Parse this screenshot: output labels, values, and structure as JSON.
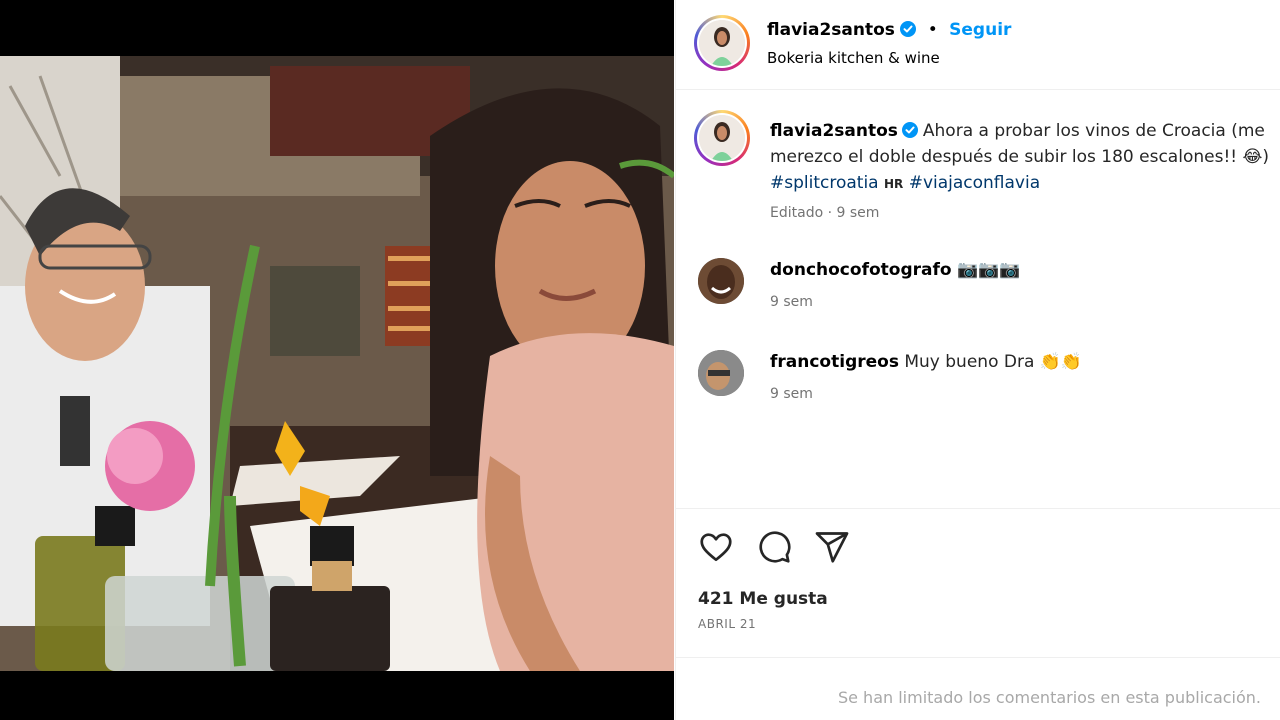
{
  "post": {
    "photo_icon": "photo",
    "author": {
      "username": "flavia2santos",
      "verified": true,
      "location": "Bokeria kitchen & wine",
      "avatar_icon": "avatar"
    },
    "follow_label": "Seguir",
    "separator": "•",
    "caption": {
      "username": "flavia2santos",
      "text": "Ahora a probar los vinos de Croacia (me merezco el doble después de subir los 180 escalones!! 😂)",
      "hashtag1": "#splitcroatia",
      "flag_label": "HR",
      "hashtag2": "#viajaconflavia",
      "edited": "Editado",
      "time": "9 sem"
    },
    "comments": [
      {
        "username": "donchocofotografo",
        "text": "📷📷📷",
        "time": "9 sem"
      },
      {
        "username": "francotigreos",
        "text": "Muy bueno Dra 👏👏",
        "time": "9 sem"
      }
    ],
    "actions": {
      "like_icon": "heart-icon",
      "comment_icon": "comment-icon",
      "share_icon": "share-icon"
    },
    "likes": "421 Me gusta",
    "date": "ABRIL 21",
    "comments_limited": "Se han limitado los comentarios en esta publicación."
  }
}
